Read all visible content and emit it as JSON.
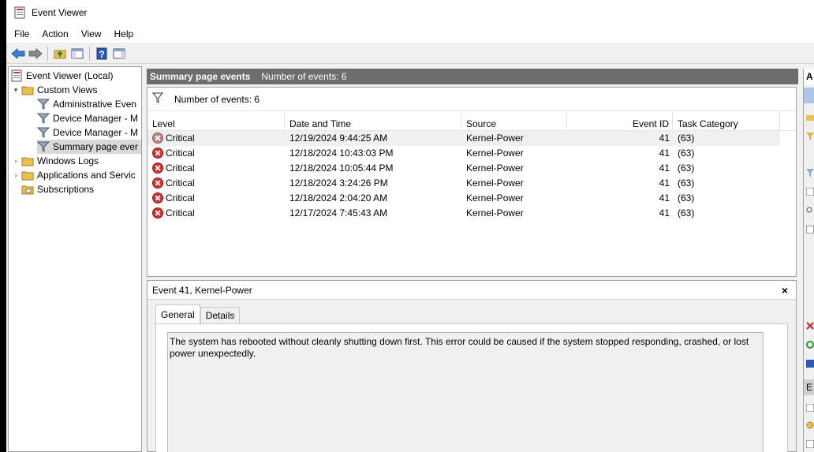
{
  "window": {
    "title": "Event Viewer"
  },
  "menu": [
    "File",
    "Action",
    "View",
    "Help"
  ],
  "toolbar": {
    "icons": [
      "back-arrow-icon",
      "forward-arrow-icon",
      "up-folder-icon",
      "show-hide-tree-icon",
      "help-icon",
      "show-hide-action-pane-icon"
    ]
  },
  "tree": {
    "root": "Event Viewer (Local)",
    "custom_views": "Custom Views",
    "custom_items": [
      "Administrative Even",
      "Device Manager - M",
      "Device Manager - M",
      "Summary page ever"
    ],
    "windows_logs": "Windows Logs",
    "apps_services": "Applications and Servic",
    "subscriptions": "Subscriptions"
  },
  "center": {
    "title": "Summary page events",
    "count_label": "Number of events: 6",
    "filter_label": "Number of events: 6",
    "columns": [
      "Level",
      "Date and Time",
      "Source",
      "Event ID",
      "Task Category"
    ],
    "rows": [
      {
        "level": "Critical",
        "date": "12/19/2024 9:44:25 AM",
        "source": "Kernel-Power",
        "id": "41",
        "category": "(63)"
      },
      {
        "level": "Critical",
        "date": "12/18/2024 10:43:03 PM",
        "source": "Kernel-Power",
        "id": "41",
        "category": "(63)"
      },
      {
        "level": "Critical",
        "date": "12/18/2024 10:05:44 PM",
        "source": "Kernel-Power",
        "id": "41",
        "category": "(63)"
      },
      {
        "level": "Critical",
        "date": "12/18/2024 3:24:26 PM",
        "source": "Kernel-Power",
        "id": "41",
        "category": "(63)"
      },
      {
        "level": "Critical",
        "date": "12/18/2024 2:04:20 AM",
        "source": "Kernel-Power",
        "id": "41",
        "category": "(63)"
      },
      {
        "level": "Critical",
        "date": "12/17/2024 7:45:43 AM",
        "source": "Kernel-Power",
        "id": "41",
        "category": "(63)"
      }
    ]
  },
  "detail": {
    "title": "Event 41, Kernel-Power",
    "close": "×",
    "tabs": [
      "General",
      "Details"
    ],
    "description": "The system has rebooted without cleanly shutting down first. This error could be caused if the system stopped responding, crashed, or lost power unexpectedly."
  },
  "actions": {
    "head": "A",
    "section2": "E"
  },
  "colors": {
    "header_bg": "#6d6d6d",
    "selected_row": "#f0f0f0",
    "critical": "#d32f2f",
    "actions_sub": "#a8c8e8"
  }
}
